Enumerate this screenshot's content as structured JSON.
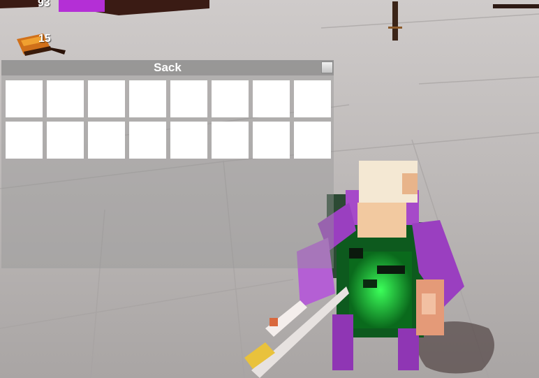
{
  "hud": {
    "mana_value": "93",
    "mana_color": "#b42fd6",
    "item_count": "15",
    "item_icon": "log-icon"
  },
  "sack": {
    "title": "Sack",
    "slot_count": 16,
    "slots": [
      {
        "item": ""
      },
      {
        "item": ""
      },
      {
        "item": ""
      },
      {
        "item": ""
      },
      {
        "item": ""
      },
      {
        "item": ""
      },
      {
        "item": ""
      },
      {
        "item": ""
      },
      {
        "item": ""
      },
      {
        "item": ""
      },
      {
        "item": ""
      },
      {
        "item": ""
      },
      {
        "item": ""
      },
      {
        "item": ""
      },
      {
        "item": ""
      },
      {
        "item": ""
      }
    ]
  }
}
